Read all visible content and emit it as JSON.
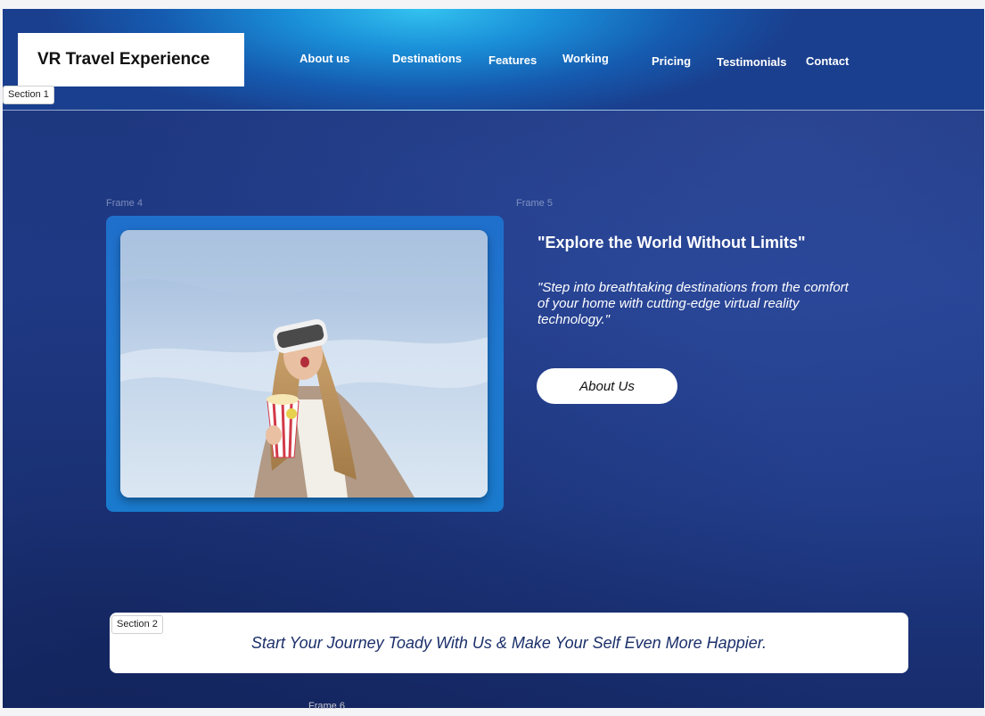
{
  "header": {
    "logo": "VR Travel Experience",
    "nav": [
      {
        "label": "About us"
      },
      {
        "label": "Destinations"
      },
      {
        "label": "Features"
      },
      {
        "label": "Working"
      },
      {
        "label": "Pricing"
      },
      {
        "label": "Testimonials"
      },
      {
        "label": "Contact"
      }
    ]
  },
  "labels": {
    "section1": "Section 1",
    "section2": "Section 2",
    "frame4": "Frame 4",
    "frame5": "Frame 5",
    "frame6": "Frame 6"
  },
  "hero": {
    "headline": "\"Explore the World Without Limits\"",
    "subtext": "\"Step into breathtaking destinations from the comfort of your home with cutting-edge virtual reality technology.\"",
    "button": "About Us"
  },
  "banner": {
    "text": "Start Your Journey Toady With Us & Make Your Self Even More Happier."
  },
  "colors": {
    "background": "#1f3a86",
    "header_glow": "#33c3f0",
    "frame_blue": "#1e78cf",
    "banner_text": "#1b2f6a"
  }
}
